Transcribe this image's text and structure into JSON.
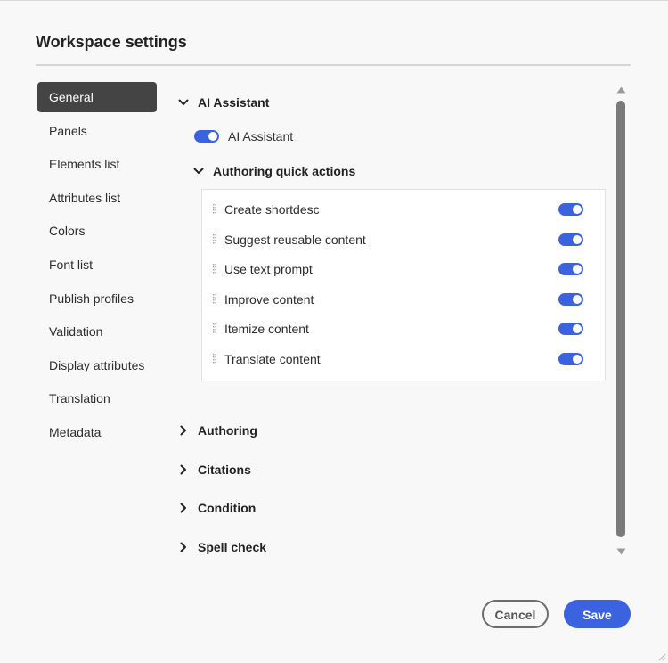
{
  "dialog": {
    "title": "Workspace settings"
  },
  "sidebar": {
    "items": [
      {
        "label": "General",
        "active": true
      },
      {
        "label": "Panels"
      },
      {
        "label": "Elements list"
      },
      {
        "label": "Attributes list"
      },
      {
        "label": "Colors"
      },
      {
        "label": "Font list"
      },
      {
        "label": "Publish profiles"
      },
      {
        "label": "Validation"
      },
      {
        "label": "Display attributes"
      },
      {
        "label": "Translation"
      },
      {
        "label": "Metadata"
      }
    ]
  },
  "content": {
    "ai_section": {
      "title": "AI Assistant",
      "expanded": true,
      "toggle_label": "AI Assistant",
      "toggle_on": true
    },
    "quick_actions": {
      "title": "Authoring quick actions",
      "expanded": true,
      "items": [
        {
          "label": "Create shortdesc",
          "on": true
        },
        {
          "label": "Suggest reusable content",
          "on": true
        },
        {
          "label": "Use text prompt",
          "on": true
        },
        {
          "label": "Improve content",
          "on": true
        },
        {
          "label": "Itemize content",
          "on": true
        },
        {
          "label": "Translate content",
          "on": true
        }
      ]
    },
    "collapsed_sections": [
      {
        "label": "Authoring"
      },
      {
        "label": "Citations"
      },
      {
        "label": "Condition"
      },
      {
        "label": "Spell check"
      }
    ]
  },
  "footer": {
    "cancel_label": "Cancel",
    "save_label": "Save"
  },
  "icons": {
    "expanded": "chevron-down-icon",
    "collapsed": "chevron-right-icon",
    "drag": "drag-handle-icon"
  },
  "colors": {
    "accent": "#3b63e0",
    "active_nav": "#444444"
  }
}
